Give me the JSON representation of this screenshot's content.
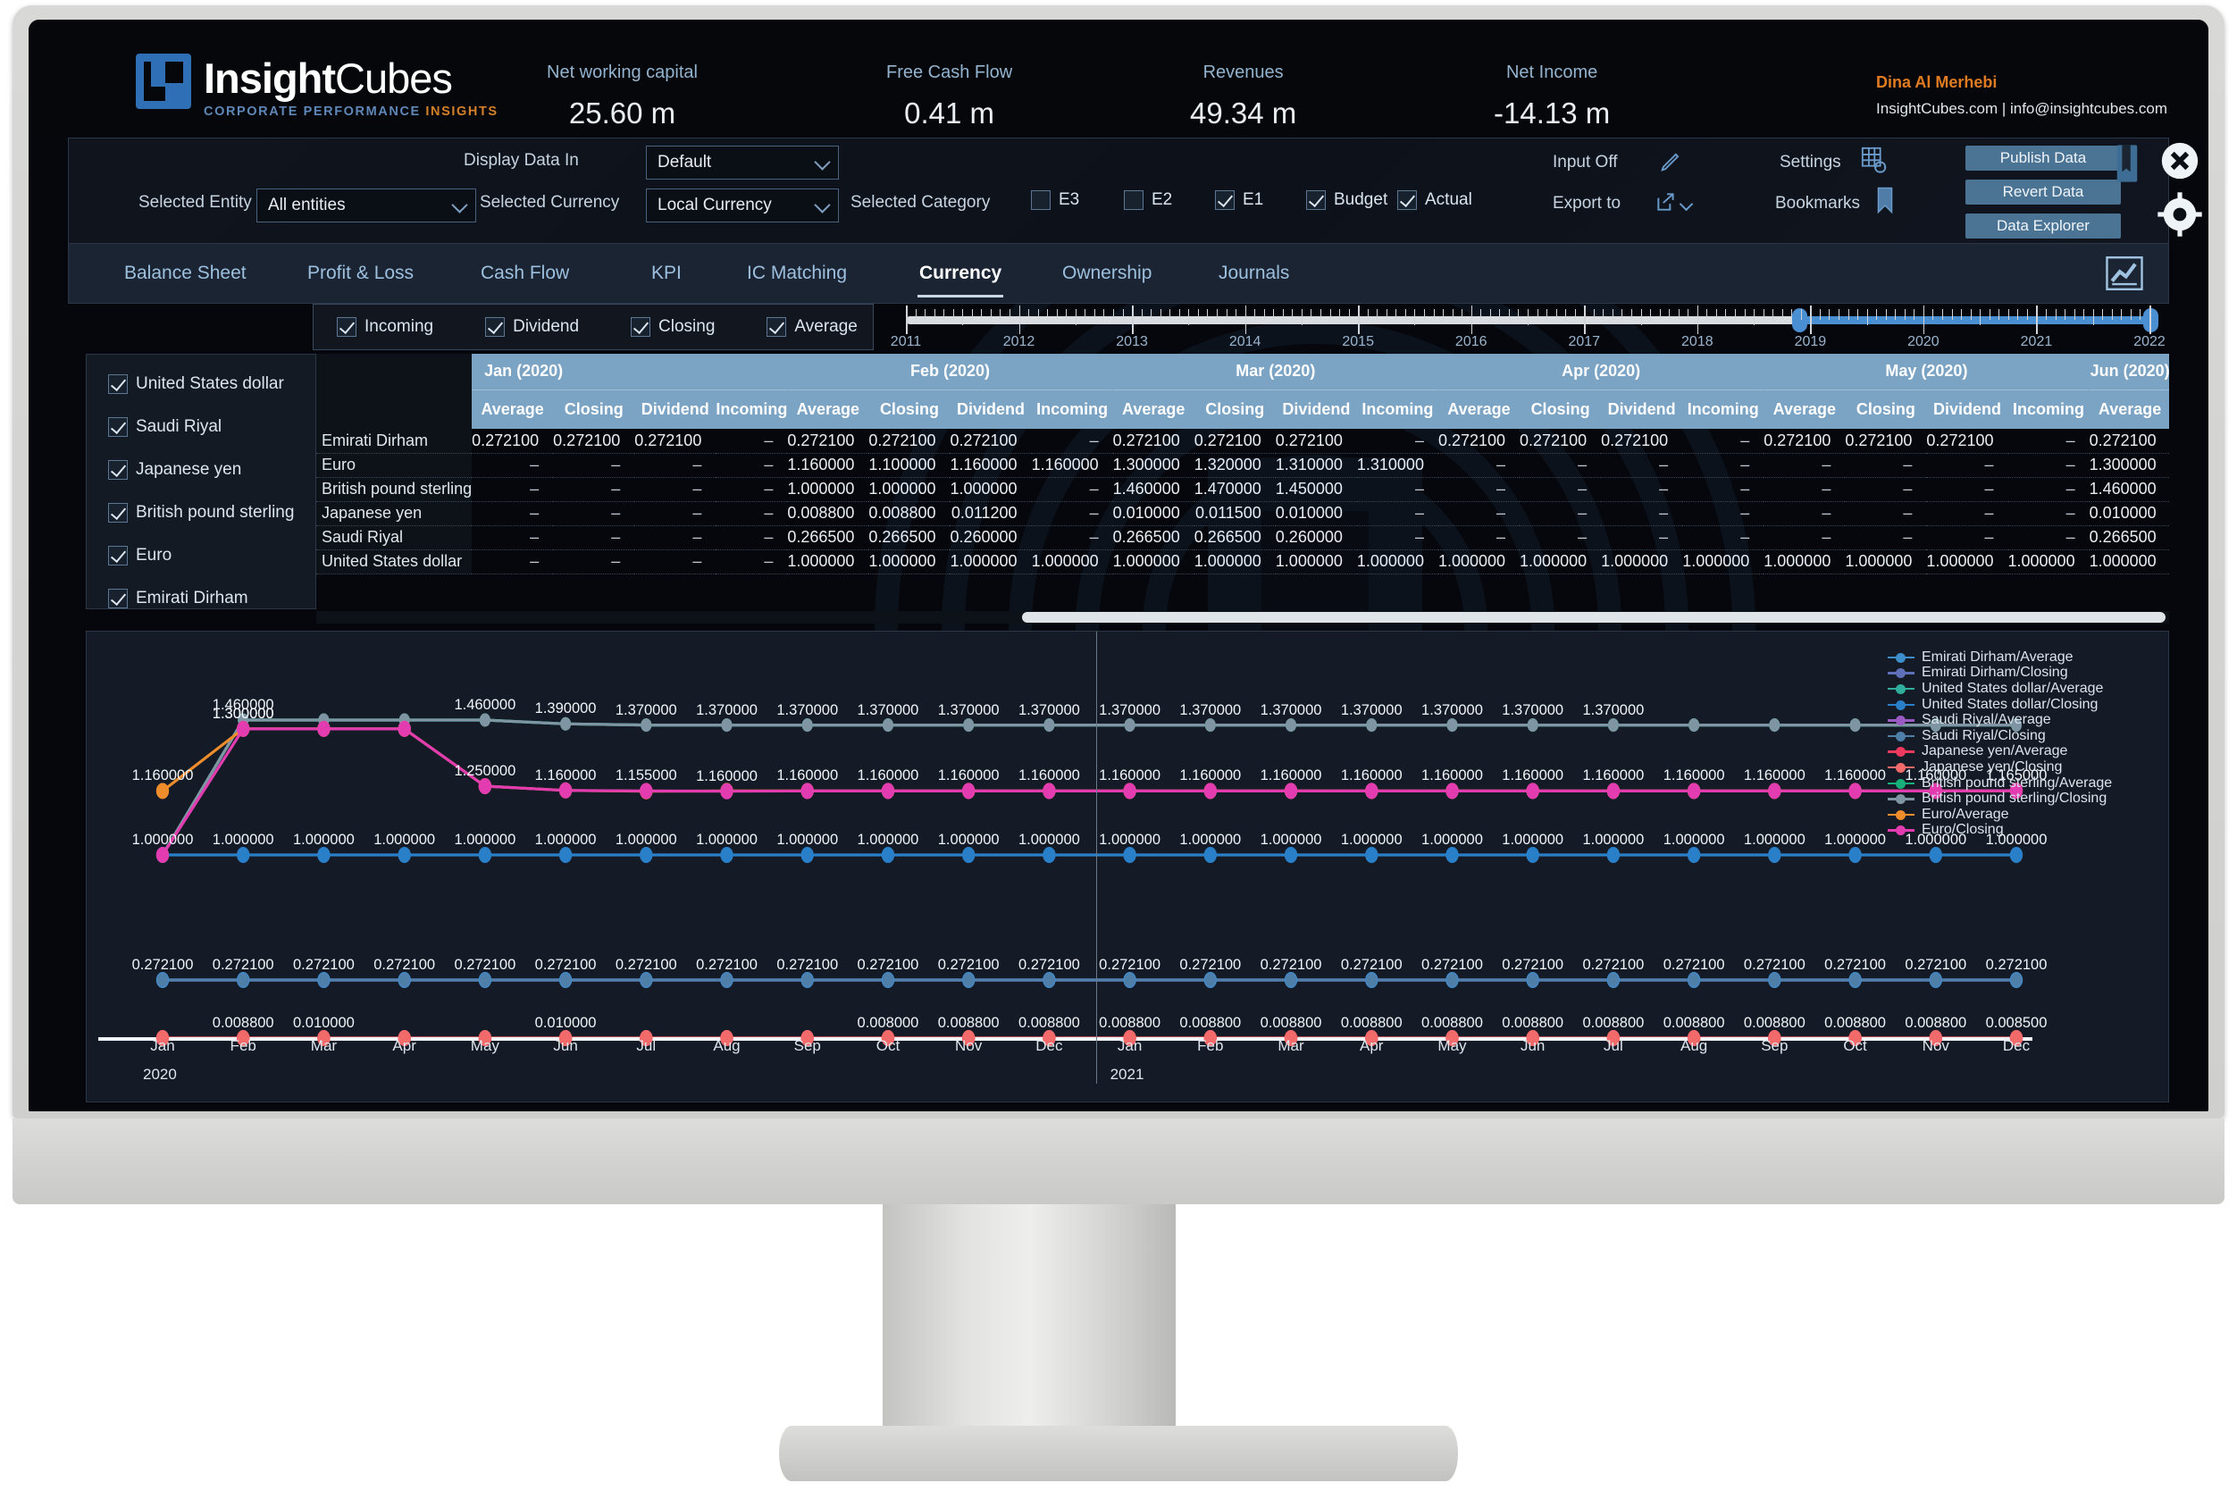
{
  "brand": {
    "name_bold": "Insight",
    "name_light": "Cubes",
    "tagline_1": "CORPORATE PERFORMANCE ",
    "tagline_2": "INSIGHTS",
    "accent": "#2f6fb5",
    "orange": "#d4802a"
  },
  "kpis": [
    {
      "label": "Net working capital",
      "value": "25.60 m"
    },
    {
      "label": "Free Cash Flow",
      "value": "0.41 m"
    },
    {
      "label": "Revenues",
      "value": "49.34 m"
    },
    {
      "label": "Net Income",
      "value": "-14.13 m"
    }
  ],
  "user": {
    "name": "Dina Al Merhebi",
    "site": "InsightCubes.com | info@insightcubes.com"
  },
  "controls": {
    "display_data_in_label": "Display Data In",
    "display_data_in_value": "Default",
    "selected_entity_label": "Selected Entity",
    "selected_entity_value": "All entities",
    "selected_currency_label": "Selected Currency",
    "selected_currency_value": "Local Currency",
    "selected_category_label": "Selected Category",
    "categories": [
      {
        "label": "E3",
        "checked": false
      },
      {
        "label": "E2",
        "checked": false
      },
      {
        "label": "E1",
        "checked": true
      },
      {
        "label": "Budget",
        "checked": true
      },
      {
        "label": "Actual",
        "checked": true
      }
    ],
    "input_off_label": "Input Off",
    "export_to_label": "Export to",
    "settings_label": "Settings",
    "bookmarks_label": "Bookmarks",
    "buttons": [
      "Publish Data",
      "Revert Data",
      "Data Explorer"
    ]
  },
  "tabs": [
    {
      "label": "Balance Sheet",
      "active": false
    },
    {
      "label": "Profit & Loss",
      "active": false
    },
    {
      "label": "Cash Flow",
      "active": false
    },
    {
      "label": "KPI",
      "active": false
    },
    {
      "label": "IC Matching",
      "active": false
    },
    {
      "label": "Currency",
      "active": true
    },
    {
      "label": "Ownership",
      "active": false
    },
    {
      "label": "Journals",
      "active": false
    }
  ],
  "measure_filters": [
    {
      "label": "Incoming",
      "checked": true
    },
    {
      "label": "Dividend",
      "checked": true
    },
    {
      "label": "Closing",
      "checked": true
    },
    {
      "label": "Average",
      "checked": true
    }
  ],
  "timeline": {
    "years": [
      "2011",
      "2012",
      "2013",
      "2014",
      "2015",
      "2016",
      "2017",
      "2018",
      "2019",
      "2020",
      "2021",
      "2022"
    ],
    "selection_start": "2019",
    "selection_end": "2022"
  },
  "currency_list": [
    {
      "label": "United States dollar",
      "checked": true
    },
    {
      "label": "Saudi Riyal",
      "checked": true
    },
    {
      "label": "Japanese yen",
      "checked": true
    },
    {
      "label": "British pound sterling",
      "checked": true
    },
    {
      "label": "Euro",
      "checked": true
    },
    {
      "label": "Emirati Dirham",
      "checked": true
    }
  ],
  "table": {
    "measures": [
      "Average",
      "Closing",
      "Dividend",
      "Incoming"
    ],
    "months": [
      "Jan (2020)",
      "Feb (2020)",
      "Mar (2020)",
      "Apr (2020)",
      "May (2020)",
      "Jun (2020)"
    ],
    "rows": [
      {
        "name": "Emirati Dirham",
        "cells": [
          "0.272100",
          "0.272100",
          "0.272100",
          "–",
          "0.272100",
          "0.272100",
          "0.272100",
          "–",
          "0.272100",
          "0.272100",
          "0.272100",
          "–",
          "0.272100",
          "0.272100",
          "0.272100",
          "–",
          "0.272100",
          "0.272100",
          "0.272100",
          "–",
          "0.272100"
        ]
      },
      {
        "name": "Euro",
        "cells": [
          "–",
          "–",
          "–",
          "–",
          "1.160000",
          "1.100000",
          "1.160000",
          "1.160000",
          "1.300000",
          "1.320000",
          "1.310000",
          "1.310000",
          "–",
          "–",
          "–",
          "–",
          "–",
          "–",
          "–",
          "–",
          "1.300000"
        ]
      },
      {
        "name": "British pound sterling",
        "cells": [
          "–",
          "–",
          "–",
          "–",
          "1.000000",
          "1.000000",
          "1.000000",
          "–",
          "1.460000",
          "1.470000",
          "1.450000",
          "–",
          "–",
          "–",
          "–",
          "–",
          "–",
          "–",
          "–",
          "–",
          "1.460000"
        ]
      },
      {
        "name": "Japanese yen",
        "cells": [
          "–",
          "–",
          "–",
          "–",
          "0.008800",
          "0.008800",
          "0.011200",
          "–",
          "0.010000",
          "0.011500",
          "0.010000",
          "–",
          "–",
          "–",
          "–",
          "–",
          "–",
          "–",
          "–",
          "–",
          "0.010000"
        ]
      },
      {
        "name": "Saudi Riyal",
        "cells": [
          "–",
          "–",
          "–",
          "–",
          "0.266500",
          "0.266500",
          "0.260000",
          "–",
          "0.266500",
          "0.266500",
          "0.260000",
          "–",
          "–",
          "–",
          "–",
          "–",
          "–",
          "–",
          "–",
          "–",
          "0.266500"
        ]
      },
      {
        "name": "United States dollar",
        "cells": [
          "–",
          "–",
          "–",
          "–",
          "1.000000",
          "1.000000",
          "1.000000",
          "1.000000",
          "1.000000",
          "1.000000",
          "1.000000",
          "1.000000",
          "1.000000",
          "1.000000",
          "1.000000",
          "1.000000",
          "1.000000",
          "1.000000",
          "1.000000",
          "1.000000",
          "1.000000"
        ]
      }
    ]
  },
  "chart_data": {
    "type": "line",
    "title": "",
    "xlabel": "",
    "ylabel": "",
    "grid": false,
    "legend_position": "right",
    "x": [
      "Jan",
      "Feb",
      "Mar",
      "Apr",
      "May",
      "Jun",
      "Jul",
      "Aug",
      "Sep",
      "Oct",
      "Nov",
      "Dec",
      "Jan",
      "Feb",
      "Mar",
      "Apr",
      "May",
      "Jun",
      "Jul",
      "Aug",
      "Sep",
      "Oct",
      "Nov",
      "Dec"
    ],
    "year_groups": [
      {
        "year": "2020",
        "start_index": 0
      },
      {
        "year": "2021",
        "start_index": 12
      }
    ],
    "series": [
      {
        "name": "Emirati Dirham/Average",
        "color": "#3d8ecb",
        "values": [
          0.2721,
          0.2721,
          0.2721,
          0.2721,
          0.2721,
          0.2721,
          0.2721,
          0.2721,
          0.2721,
          0.2721,
          0.2721,
          0.2721,
          0.2721,
          0.2721,
          0.2721,
          0.2721,
          0.2721,
          0.2721,
          0.2721,
          0.2721,
          0.2721,
          0.2721,
          0.2721,
          0.2721
        ],
        "labels": [
          "0.272100",
          "0.272100",
          "0.272100",
          "0.272100",
          "0.272100",
          "0.272100",
          "0.272100",
          "0.272100",
          "0.272100",
          "0.272100",
          "0.272100",
          "0.272100",
          "0.272100",
          "0.272100",
          "0.272100",
          "0.272100",
          "0.272100",
          "0.272100",
          "0.272100",
          "0.272100",
          "0.272100",
          "0.272100",
          "0.272100",
          "0.272100"
        ]
      },
      {
        "name": "Emirati Dirham/Closing",
        "color": "#6070b8",
        "values": [
          0.2721,
          0.2721,
          0.2721,
          0.2721,
          0.2721,
          0.2721,
          0.2721,
          0.2721,
          0.2721,
          0.2721,
          0.2721,
          0.2721,
          0.2721,
          0.2721,
          0.2721,
          0.2721,
          0.2721,
          0.2721,
          0.2721,
          0.2721,
          0.2721,
          0.2721,
          0.2721,
          0.2721
        ]
      },
      {
        "name": "United States dollar/Average",
        "color": "#2fae9e",
        "values": [
          1.0,
          1.46,
          1.46,
          1.46,
          1.46,
          1.39,
          1.37,
          1.37,
          1.37,
          1.37,
          1.37,
          1.37,
          1.37,
          1.37,
          1.37,
          1.37,
          1.37,
          1.37,
          1.37,
          1.37,
          1.37,
          1.37,
          1.37,
          1.37
        ]
      },
      {
        "name": "United States dollar/Closing",
        "color": "#2a7fc9",
        "values": [
          1.0,
          1.0,
          1.0,
          1.0,
          1.0,
          1.0,
          1.0,
          1.0,
          1.0,
          1.0,
          1.0,
          1.0,
          1.0,
          1.0,
          1.0,
          1.0,
          1.0,
          1.0,
          1.0,
          1.0,
          1.0,
          1.0,
          1.0,
          1.0
        ],
        "labels": [
          "1.000000",
          "1.000000",
          "1.000000",
          "1.000000",
          "1.000000",
          "1.000000",
          "1.000000",
          "1.000000",
          "1.000000",
          "1.000000",
          "1.000000",
          "1.000000",
          "1.000000",
          "1.000000",
          "1.000000",
          "1.000000",
          "1.000000",
          "1.000000",
          "1.000000",
          "1.000000",
          "1.000000",
          "1.000000",
          "1.000000",
          "1.000000"
        ]
      },
      {
        "name": "Saudi Riyal/Average",
        "color": "#9b59c4",
        "values": [
          0.2721,
          0.2721,
          0.2721,
          0.2721,
          0.2721,
          0.2721,
          0.2721,
          0.2721,
          0.2721,
          0.2721,
          0.2721,
          0.2721,
          0.2721,
          0.2721,
          0.2721,
          0.2721,
          0.2721,
          0.2721,
          0.2721,
          0.2721,
          0.2721,
          0.2721,
          0.2721,
          0.2721
        ]
      },
      {
        "name": "Saudi Riyal/Closing",
        "color": "#4e7fa8",
        "values": [
          0.2721,
          0.2721,
          0.2721,
          0.2721,
          0.2721,
          0.2721,
          0.2721,
          0.2721,
          0.2721,
          0.2721,
          0.2721,
          0.2721,
          0.2721,
          0.2721,
          0.2721,
          0.2721,
          0.2721,
          0.2721,
          0.2721,
          0.2721,
          0.2721,
          0.2721,
          0.2721,
          0.2721
        ]
      },
      {
        "name": "Japanese yen/Average",
        "color": "#ef3a60",
        "values": [
          0.0088,
          0.0088,
          0.01,
          0.01,
          0.01,
          0.01,
          0.0085,
          0.0085,
          0.0085,
          0.008,
          0.0088,
          0.0088,
          0.0088,
          0.0088,
          0.0088,
          0.0088,
          0.0088,
          0.0088,
          0.0088,
          0.0088,
          0.0088,
          0.0088,
          0.0088,
          0.0085
        ],
        "labels": [
          "",
          "0.008800",
          "0.010000",
          "",
          "",
          "0.010000",
          "",
          "",
          "",
          "0.008000",
          "0.008800",
          "0.008800",
          "0.008800",
          "0.008800",
          "0.008800",
          "0.008800",
          "0.008800",
          "0.008800",
          "0.008800",
          "0.008800",
          "0.008800",
          "0.008800",
          "0.008800",
          "0.008500"
        ]
      },
      {
        "name": "Japanese yen/Closing",
        "color": "#f26a6a",
        "values": [
          0.0088,
          0.0088,
          0.01,
          0.01,
          0.01,
          0.01,
          0.0085,
          0.0085,
          0.0085,
          0.008,
          0.0088,
          0.0088,
          0.0088,
          0.0088,
          0.0088,
          0.0088,
          0.0088,
          0.0088,
          0.0088,
          0.0088,
          0.0088,
          0.0088,
          0.0088,
          0.0085
        ]
      },
      {
        "name": "British pound sterling/Average",
        "color": "#17b07a",
        "values": [
          1.0,
          1.46,
          1.46,
          1.46,
          1.46,
          1.39,
          1.37,
          1.37,
          1.37,
          1.37,
          1.37,
          1.37,
          1.37,
          1.37,
          1.37,
          1.37,
          1.37,
          1.37,
          1.37,
          1.37,
          1.37,
          1.37,
          1.37,
          1.37
        ],
        "labels": [
          "",
          "1.460000",
          "",
          "",
          "1.460000",
          "1.390000",
          "1.370000",
          "1.370000",
          "1.370000",
          "1.370000",
          "1.370000",
          "1.370000",
          "1.370000",
          "1.370000",
          "1.370000",
          "1.370000",
          "1.370000",
          "1.370000",
          "1.370000",
          "",
          "",
          " ",
          "",
          ""
        ]
      },
      {
        "name": "British pound sterling/Closing",
        "color": "#7f95a3",
        "values": [
          1.0,
          1.46,
          1.46,
          1.46,
          1.46,
          1.39,
          1.37,
          1.37,
          1.37,
          1.37,
          1.37,
          1.37,
          1.37,
          1.37,
          1.37,
          1.37,
          1.37,
          1.37,
          1.37,
          1.37,
          1.37,
          1.37,
          1.37,
          1.37
        ]
      },
      {
        "name": "Euro/Average",
        "color": "#ef8c2b",
        "values": [
          1.16,
          1.3,
          1.3,
          1.3,
          1.25,
          1.17,
          1.155,
          1.16,
          1.16,
          1.16,
          1.16,
          1.16,
          1.16,
          1.16,
          1.16,
          1.16,
          1.16,
          1.16,
          1.16,
          1.16,
          1.16,
          1.16,
          1.16,
          1.165
        ],
        "labels": [
          "1.160000",
          "1.300000",
          "",
          "",
          "1.250000",
          "",
          "",
          "",
          "",
          "",
          "",
          "",
          "",
          "",
          "",
          "",
          "",
          "",
          "",
          "",
          "",
          "",
          "",
          ""
        ]
      },
      {
        "name": "Euro/Closing",
        "color": "#e33cb1",
        "values": [
          1.0,
          1.3,
          1.3,
          1.3,
          1.25,
          1.17,
          1.16,
          1.155,
          1.16,
          1.16,
          1.16,
          1.16,
          1.16,
          1.16,
          1.16,
          1.16,
          1.16,
          1.16,
          1.16,
          1.16,
          1.16,
          1.16,
          1.16,
          1.165
        ],
        "labels": [
          "",
          "1.300000",
          "",
          "",
          "",
          "1.160000",
          "1.155000",
          "1.160000",
          "1.160000",
          "1.160000",
          "1.160000",
          "1.160000",
          "1.160000",
          "1.160000",
          "1.160000",
          "1.160000",
          "1.160000",
          "1.160000",
          "1.160000",
          "1.160000",
          "1.160000",
          "1.160000",
          "1.160000",
          "1.165000"
        ]
      }
    ],
    "annotation_rows": {
      "row_1p4": [
        "1.460000",
        "1.460000",
        "1.390000",
        "1.370000",
        "1.370000",
        "1.370000",
        "1.370000",
        "1.370000",
        "1.370000",
        "1.370000",
        "1.370000",
        "1.370000",
        "1.370000",
        "1.370000",
        "1.370000",
        "1.370000",
        "1.370000"
      ],
      "row_1p16": [
        "1.160000",
        "1.300000",
        "1.300000",
        "1.250000",
        "1.160000",
        "1.155000",
        "1.160000",
        "1.160000",
        "1.160000",
        "1.160000",
        "1.160000",
        "1.160000",
        "1.160000",
        "1.160000",
        "1.160000",
        "1.160000",
        "1.160000",
        "1.160000",
        "1.165000"
      ],
      "row_1p0": [
        "1.000000"
      ],
      "row_0p27": [
        "0.272100"
      ],
      "row_0p008": [
        "0.008800",
        "0.010000",
        "0.010000",
        "0.008000",
        "0.008800",
        "0.008800",
        "0.008500"
      ]
    }
  },
  "icons": {
    "pencil": "pencil-icon",
    "export": "export-icon",
    "settings": "settings-grid-icon",
    "bookmark": "bookmark-icon",
    "book": "book-icon",
    "close": "close-circle-icon",
    "gear": "gear-icon",
    "chart": "chart-icon"
  }
}
